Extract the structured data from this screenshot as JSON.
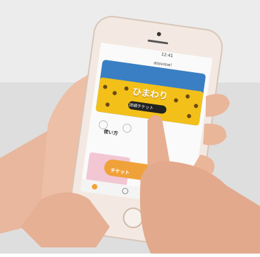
{
  "photo": {
    "description_icons": [
      "phone-icon",
      "hand-icon"
    ]
  },
  "screen": {
    "status_time": "12:41",
    "logo_text": "asoview!",
    "hero_title": "ひまわり",
    "hero_button": "詳細チケット",
    "section_title": "使い方",
    "cta_button": "チケット"
  },
  "colors": {
    "hero_yellow": "#f3c01a",
    "cta_orange": "#f0a23a",
    "background": "#e9e9e9"
  }
}
